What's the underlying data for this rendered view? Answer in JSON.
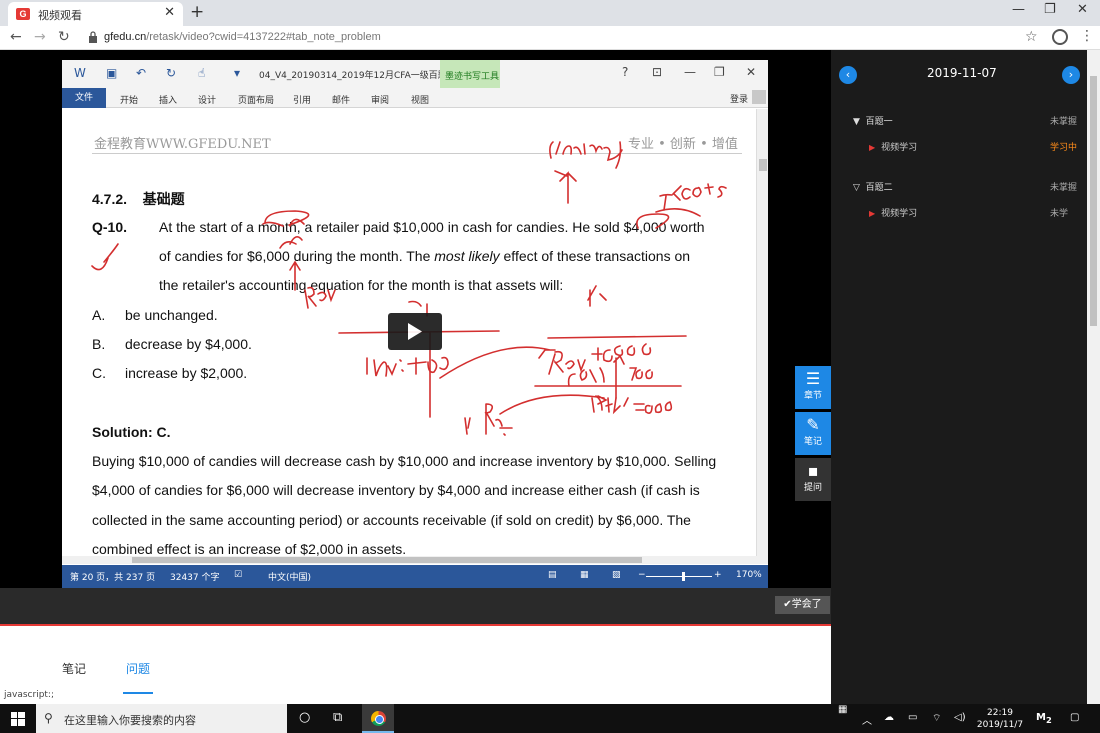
{
  "browser": {
    "tab_title": "视频观看",
    "favicon": "G",
    "url_host": "gfedu.cn",
    "url_path": "/retask/video?cwid=4137222#tab_note_problem"
  },
  "word": {
    "doc_title": "04_V4_20190314_2019年12月CFA一级百题...",
    "ink_tools": "墨迹书写工具",
    "ink_tab": "笔",
    "help": "?",
    "ribbon": [
      "文件",
      "开始",
      "插入",
      "设计",
      "页面布局",
      "引用",
      "邮件",
      "审阅",
      "视图"
    ],
    "login": "登录",
    "header_left": "金程教育WWW.GFEDU.NET",
    "header_right": "专业 • 创新 • 增值",
    "section_num": "4.7.2.",
    "section_title": "基础题",
    "q_label": "Q-10.",
    "q_line1": "At the start of a month, a retailer paid $10,000 in cash for candies. He sold $4,000 worth",
    "q_line2a": "of candies for $6,000 during the month. The ",
    "q_line2_em1": "most likely",
    "q_line2b": " effect of these transactions on",
    "q_line3": "the retailer's accounting equation for the month is that assets will:",
    "options": [
      {
        "letter": "A.",
        "text": "be unchanged."
      },
      {
        "letter": "B.",
        "text": "decrease by $4,000."
      },
      {
        "letter": "C.",
        "text": "increase by $2,000."
      }
    ],
    "solution_label": "Solution: C.",
    "solution_lines": [
      "Buying $10,000 of candies will decrease cash by $10,000 and increase inventory by $10,000. Selling",
      "$4,000 of candies for $6,000 will decrease inventory by $4,000 and increase either cash (if cash is",
      "collected in the same accounting period) or accounts receivable (if sold on credit) by $6,000. The",
      "combined effect is an increase of $2,000 in assets."
    ],
    "status": {
      "page": "第 20 页，共 237 页",
      "words": "32437 个字",
      "lang": "中文(中国)",
      "zoom": "170%",
      "zoom_level": 1.7
    }
  },
  "side_buttons": [
    {
      "label": "章节",
      "icon": "list-icon"
    },
    {
      "label": "笔记",
      "icon": "pencil-icon"
    },
    {
      "label": "提问",
      "icon": "question-icon"
    }
  ],
  "learned_button": "学会了",
  "lower_tabs": [
    "笔记",
    "问题"
  ],
  "status_link": "javascript:;",
  "sidebar": {
    "date": "2019-11-07",
    "sections": [
      {
        "title": "百题一",
        "status": "未掌握",
        "item": "视频学习",
        "item_status": "学习中",
        "item_status_color": "#ff8c1a"
      },
      {
        "title": "百题二",
        "status": "未掌握",
        "item": "视频学习",
        "item_status": "未学",
        "item_status_color": "#aaaaaa"
      }
    ]
  },
  "taskbar": {
    "search_placeholder": "在这里输入你要搜索的内容",
    "time": "22:19",
    "date": "2019/11/7",
    "notif_count": "2"
  },
  "colors": {
    "word_blue": "#2b579a",
    "accent_blue": "#1e88e5",
    "ink_red": "#d32f2f",
    "brand_red": "#e53935"
  }
}
